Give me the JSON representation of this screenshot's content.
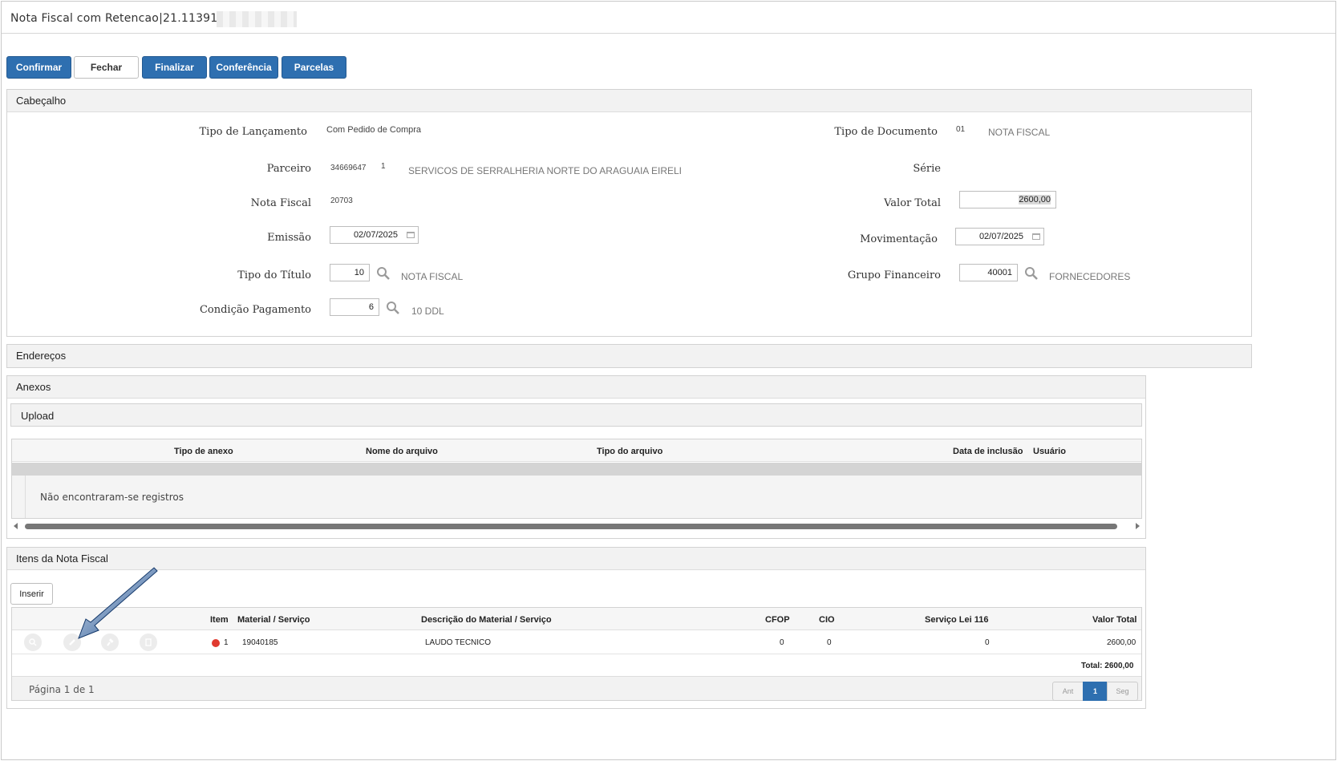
{
  "window": {
    "title": "Nota Fiscal com Retencao|21.113913|"
  },
  "toolbar": {
    "confirmar": "Confirmar",
    "fechar": "Fechar",
    "finalizar": "Finalizar",
    "conferencia": "Conferência",
    "parcelas": "Parcelas"
  },
  "cabecalho": {
    "title": "Cabeçalho",
    "tipo_lancamento": {
      "label": "Tipo de Lançamento",
      "value": "Com Pedido de Compra"
    },
    "tipo_documento": {
      "label": "Tipo de Documento",
      "code": "01",
      "desc": "NOTA FISCAL"
    },
    "parceiro": {
      "label": "Parceiro",
      "code": "34669647",
      "seq": "1",
      "name": "SERVICOS DE SERRALHERIA NORTE DO ARAGUAIA EIRELI"
    },
    "serie": {
      "label": "Série"
    },
    "nota_fiscal": {
      "label": "Nota Fiscal",
      "value": "20703"
    },
    "valor_total": {
      "label": "Valor Total",
      "value": "2600,00"
    },
    "emissao": {
      "label": "Emissão",
      "value": "02/07/2025"
    },
    "movimentacao": {
      "label": "Movimentação",
      "value": "02/07/2025"
    },
    "tipo_titulo": {
      "label": "Tipo do Título",
      "value": "10",
      "desc": "NOTA FISCAL"
    },
    "grupo_financeiro": {
      "label": "Grupo Financeiro",
      "value": "40001",
      "desc": "FORNECEDORES"
    },
    "condicao_pagamento": {
      "label": "Condição Pagamento",
      "value": "6",
      "desc": "10 DDL"
    }
  },
  "enderecos": {
    "title": "Endereços"
  },
  "anexos": {
    "title": "Anexos",
    "upload": "Upload",
    "columns": [
      "Tipo de anexo",
      "Nome do arquivo",
      "Tipo do arquivo",
      "Data de inclusão",
      "Usuário"
    ],
    "empty": "Não encontraram-se registros"
  },
  "itens": {
    "title": "Itens da Nota Fiscal",
    "inserir": "Inserir",
    "columns": {
      "item": "Item",
      "material": "Material / Serviço",
      "descricao": "Descrição do Material / Serviço",
      "cfop": "CFOP",
      "cio": "CIO",
      "servico": "Serviço Lei 116",
      "valor": "Valor Total"
    },
    "rows": [
      {
        "item": "1",
        "material": "19040185",
        "descricao": "LAUDO TECNICO",
        "cfop": "0",
        "cio": "0",
        "servico": "0",
        "valor": "2600,00",
        "status_color": "#e03a2f"
      }
    ],
    "total": "Total: 2600,00",
    "pagina": "Página 1 de 1",
    "pager": {
      "prev": "Ant",
      "current": "1",
      "next": "Seg"
    }
  },
  "colors": {
    "primary_button": "#2e6fb0",
    "annotation_arrow": "#1f4e8c"
  }
}
